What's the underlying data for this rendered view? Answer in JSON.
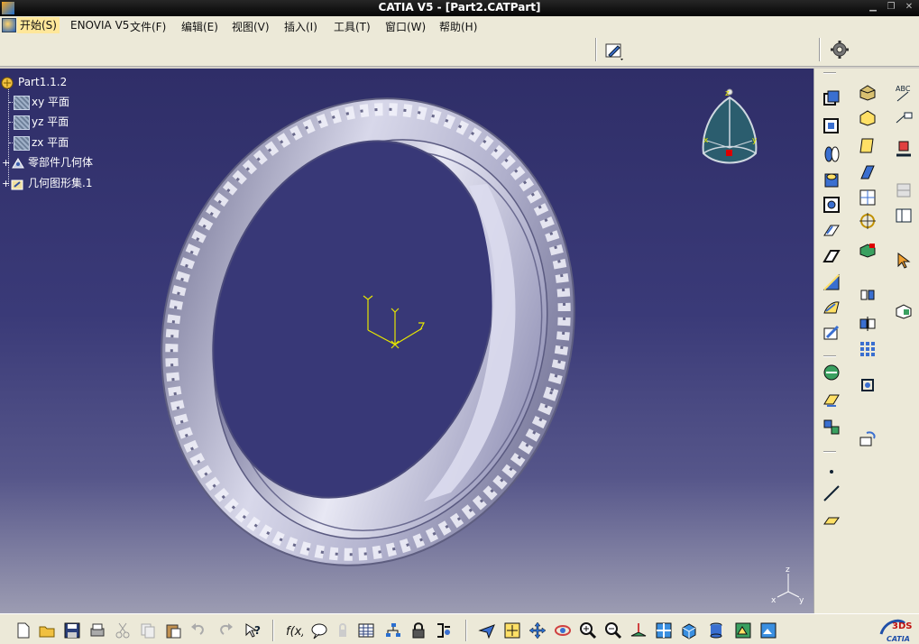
{
  "window": {
    "title": "CATIA V5 - [Part2.CATPart]"
  },
  "menu": {
    "items": [
      {
        "label": "开始(S)"
      },
      {
        "label": "ENOVIA V5"
      },
      {
        "label": "文件(F)"
      },
      {
        "label": "编辑(E)"
      },
      {
        "label": "视图(V)"
      },
      {
        "label": "插入(I)"
      },
      {
        "label": "工具(T)"
      },
      {
        "label": "窗口(W)"
      },
      {
        "label": "帮助(H)"
      }
    ]
  },
  "tree": {
    "root": "Part1.1.2",
    "items": [
      {
        "label": "xy 平面",
        "icon": "plane-icon"
      },
      {
        "label": "yz 平面",
        "icon": "plane-icon"
      },
      {
        "label": "zx 平面",
        "icon": "plane-icon"
      },
      {
        "label": "零部件几何体",
        "icon": "partbody-icon",
        "expandable": true
      },
      {
        "label": "几何图形集.1",
        "icon": "geometrical-set-icon",
        "expandable": true
      }
    ]
  },
  "compass": {
    "labels": {
      "x": "x",
      "y": "y",
      "z": "z"
    }
  },
  "triad": {
    "labels": {
      "x": "x",
      "y": "y",
      "z": "z"
    }
  },
  "logo": {
    "brand": "3DS",
    "product": "CATIA"
  },
  "colors": {
    "viewport_top": "#2f2e68",
    "viewport_bottom": "#9c9cb2",
    "model": "#c8c8dc",
    "axes": "#e6e600"
  }
}
